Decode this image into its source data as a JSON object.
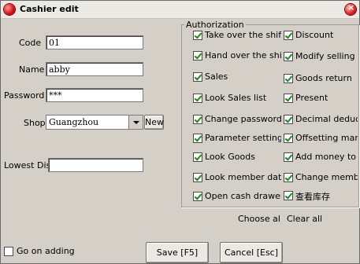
{
  "window": {
    "title": "Cashier edit"
  },
  "form": {
    "code_label": "Code",
    "code_value": "01",
    "name_label": "Name",
    "name_value": "abby",
    "password_label": "Password",
    "password_value": "***",
    "shop_label": "Shop",
    "shop_value": "Guangzhou",
    "new_label": "New",
    "lowest_discount_label": "Lowest Disc",
    "lowest_discount_value": ""
  },
  "authorization": {
    "legend": "Authorization",
    "left": [
      {
        "label": "Take over the shift",
        "checked": true
      },
      {
        "label": "Hand over the shift",
        "checked": true
      },
      {
        "label": "Sales",
        "checked": true
      },
      {
        "label": "Look Sales list",
        "checked": true
      },
      {
        "label": "Change password",
        "checked": true
      },
      {
        "label": "Parameter setting",
        "checked": true
      },
      {
        "label": "Look Goods",
        "checked": true
      },
      {
        "label": "Look member data",
        "checked": true
      },
      {
        "label": "Open cash drawer",
        "checked": true
      }
    ],
    "right": [
      {
        "label": "Discount",
        "checked": true
      },
      {
        "label": "Modify selling pric",
        "checked": true
      },
      {
        "label": "Goods return",
        "checked": true
      },
      {
        "label": "Present",
        "checked": true
      },
      {
        "label": "Decimal deductio",
        "checked": true
      },
      {
        "label": "Offsetting mark",
        "checked": true
      },
      {
        "label": "Add money to me",
        "checked": true
      },
      {
        "label": "Change member",
        "checked": true
      },
      {
        "label": "查看库存",
        "checked": true
      }
    ],
    "choose_all": "Choose al",
    "clear_all": "Clear all"
  },
  "footer": {
    "go_on_adding_label": "Go on adding",
    "go_on_adding_checked": false,
    "save_label": "Save [F5]",
    "cancel_label": "Cancel [Esc]"
  }
}
